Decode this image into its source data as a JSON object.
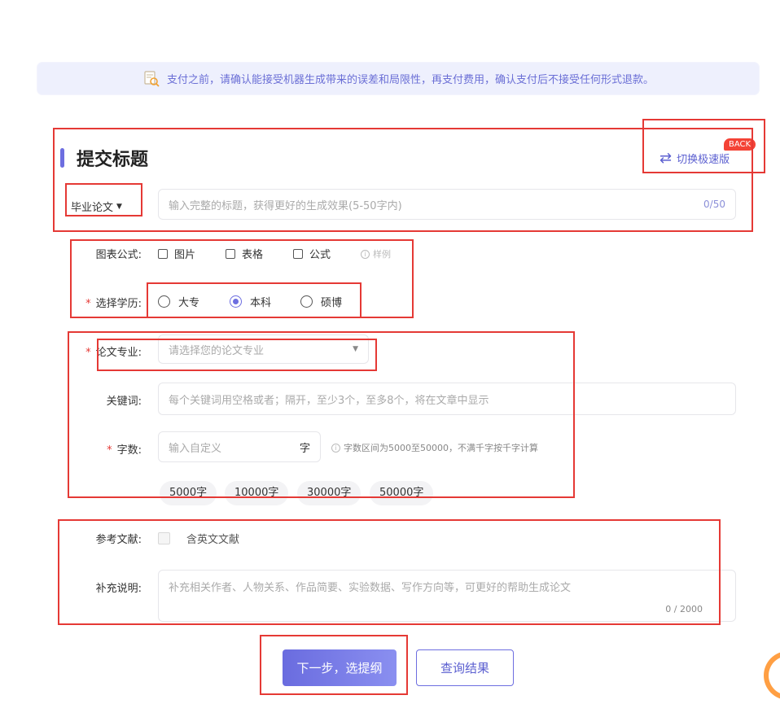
{
  "notice": {
    "text": "支付之前，请确认能接受机器生成带来的误差和局限性，再支付费用，确认支付后不接受任何形式退款。",
    "icon": "document-search-icon"
  },
  "header": {
    "title": "提交标题",
    "switch_label": "切换极速版",
    "back_badge": "BACK"
  },
  "title_row": {
    "type_select": "毕业论文",
    "placeholder": "输入完整的标题，获得更好的生成效果(5-50字内)",
    "counter": "0/50"
  },
  "figures": {
    "label": "图表公式:",
    "options": [
      "图片",
      "表格",
      "公式"
    ],
    "sample": "样例"
  },
  "education": {
    "required": "*",
    "label": "选择学历:",
    "options": [
      "大专",
      "本科",
      "硕博"
    ],
    "selected": "本科"
  },
  "major": {
    "required": "*",
    "label": "论文专业:",
    "placeholder": "请选择您的论文专业"
  },
  "keywords": {
    "label": "关键词:",
    "placeholder": "每个关键词用空格或者；隔开，至少3个，至多8个，将在文章中显示"
  },
  "words": {
    "required": "*",
    "label": "字数:",
    "placeholder": "输入自定义",
    "unit": "字",
    "hint": "字数区间为5000至50000，不满千字按千字计算",
    "presets": [
      "5000字",
      "10000字",
      "30000字",
      "50000字"
    ]
  },
  "references": {
    "label": "参考文献:",
    "option": "含英文文献"
  },
  "supplement": {
    "label": "补充说明:",
    "placeholder": "补充相关作者、人物关系、作品简要、实验数据、写作方向等，可更好的帮助生成论文",
    "counter": "0 / 2000"
  },
  "actions": {
    "next": "下一步，选提纲",
    "query": "查询结果"
  },
  "colors": {
    "accent": "#6d6ee0",
    "annotation": "#e53935",
    "notice_bg": "#eef0fd"
  }
}
